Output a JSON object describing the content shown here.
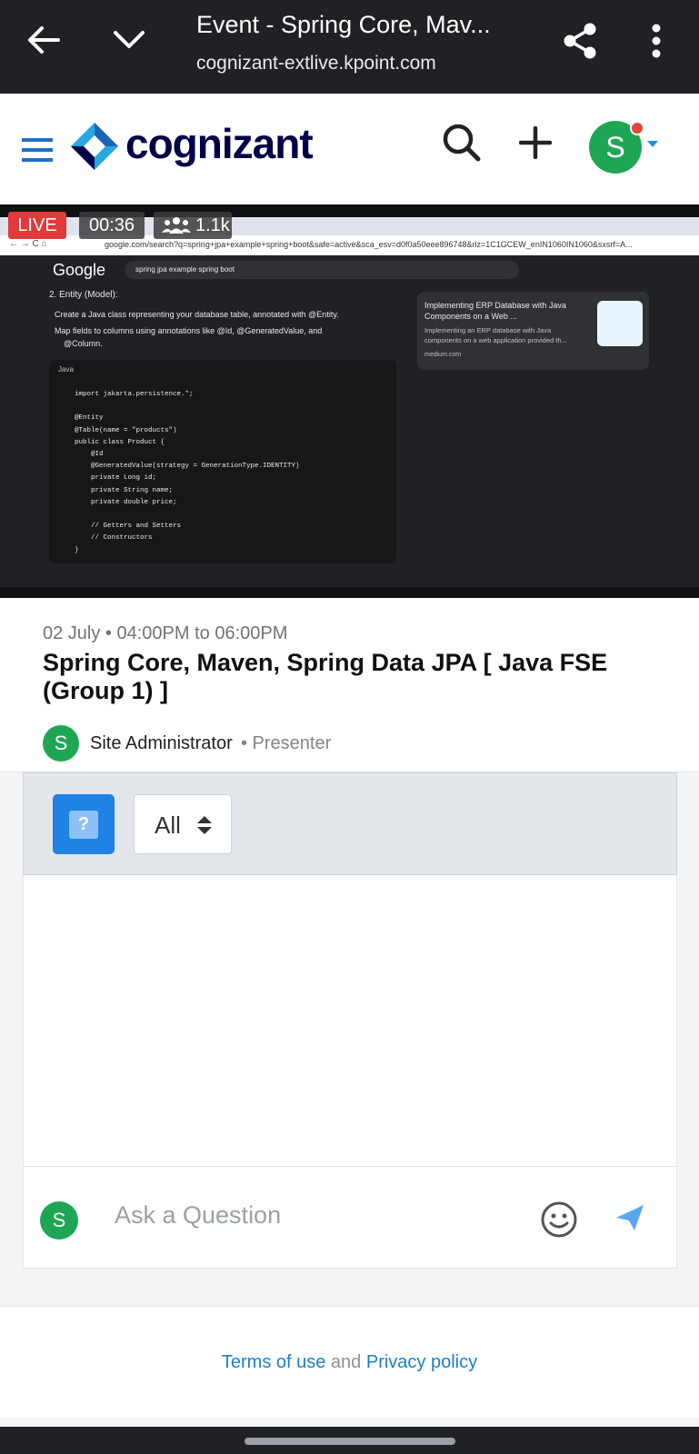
{
  "browser": {
    "title": "Event - Spring Core, Mav...",
    "url": "cognizant-extlive.kpoint.com"
  },
  "header": {
    "brand": "cognizant",
    "brand_color": "#000048",
    "icons": [
      "menu-icon",
      "search-icon",
      "plus-icon",
      "user-avatar"
    ],
    "avatar_letter": "S"
  },
  "video": {
    "live_label": "LIVE",
    "elapsed": "00:36",
    "viewers": "1.1k",
    "screen": {
      "address_url": "google.com/search?q=spring+jpa+example+spring+boot&safe=active&sca_esv=d0f0a50eee896748&rlz=1C1GCEW_enIN1060IN1060&sxsrf=A...",
      "search_brand": "Google",
      "search_query": "spring jpa example spring boot",
      "heading": "2. Entity (Model):",
      "bullet1": "Create a Java class representing your database table, annotated with @Entity.",
      "bullet2a": "Map fields to columns using annotations like @Id, @GeneratedValue, and",
      "bullet2b": "@Column.",
      "code_lang": "Java",
      "code": "import jakarta.persistence.*;\n\n@Entity\n@Table(name = \"products\")\npublic class Product {\n    @Id\n    @GeneratedValue(strategy = GenerationType.IDENTITY)\n    private Long id;\n    private String name;\n    private double price;\n\n    // Getters and Setters\n    // Constructors\n}",
      "card_title": "Implementing ERP Database with Java Components on a Web ...",
      "card_desc": "Implementing an ERP database with Java components on a web application provided th...",
      "card_source": "medium.com"
    }
  },
  "event": {
    "date": "02 July • 04:00PM to 06:00PM",
    "title": "Spring Core, Maven, Spring Data JPA [ Java FSE (Group 1) ]",
    "presenter_initial": "S",
    "presenter_name": "Site Administrator",
    "presenter_role": "• Presenter"
  },
  "qa": {
    "filter_value": "All",
    "question_btn": "?",
    "input_placeholder": "Ask a Question",
    "user_initial": "S",
    "accent": "#1f83e6"
  },
  "footer": {
    "terms": "Terms of use",
    "and": "and",
    "privacy": "Privacy policy"
  }
}
